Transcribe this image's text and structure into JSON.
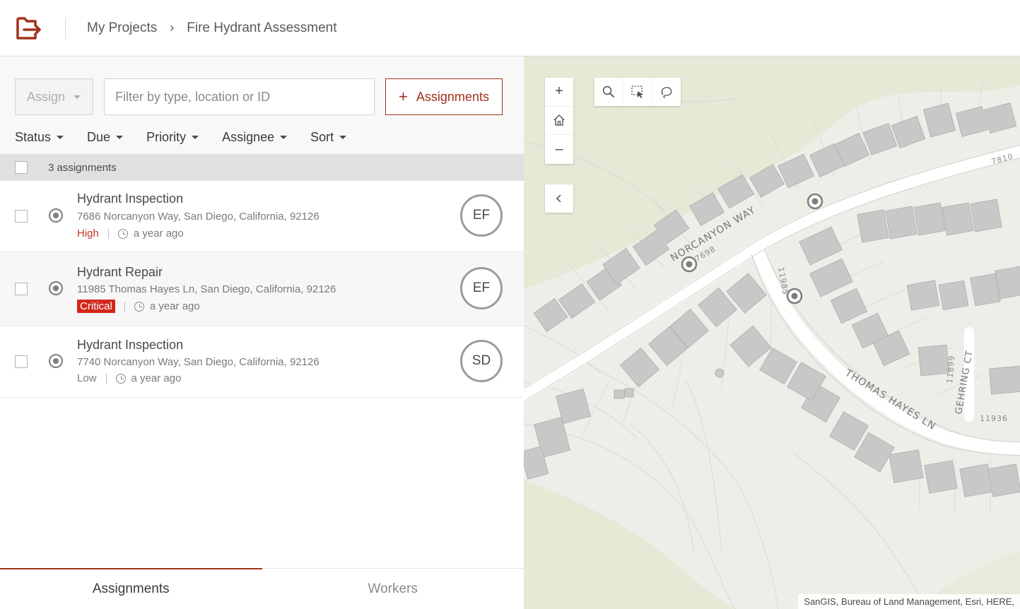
{
  "header": {
    "breadcrumbs": [
      "My Projects",
      "Fire Hydrant Assessment"
    ],
    "brand_color": "#a3301f"
  },
  "toolbar": {
    "assign_label": "Assign",
    "filter_placeholder": "Filter by type, location or ID",
    "add_label": "Assignments",
    "filters": [
      "Status",
      "Due",
      "Priority",
      "Assignee",
      "Sort"
    ]
  },
  "list": {
    "count_text": "3 assignments",
    "items": [
      {
        "title": "Hydrant Inspection",
        "address": "7686 Norcanyon Way, San Diego, California, 92126",
        "priority": "High",
        "time": "a year ago",
        "assignee": "EF"
      },
      {
        "title": "Hydrant Repair",
        "address": "11985 Thomas Hayes Ln, San Diego, California, 92126",
        "priority": "Critical",
        "time": "a year ago",
        "assignee": "EF"
      },
      {
        "title": "Hydrant Inspection",
        "address": "7740 Norcanyon Way, San Diego, California, 92126",
        "priority": "Low",
        "time": "a year ago",
        "assignee": "SD"
      }
    ]
  },
  "tabs": [
    {
      "label": "Assignments"
    },
    {
      "label": "Workers"
    }
  ],
  "map": {
    "zoom_in": "+",
    "zoom_out": "–",
    "streets": {
      "norcanyon": "NORCANYON WAY",
      "thomas_hayes": "THOMAS HAYES LN",
      "gehring": "GEHRING CT"
    },
    "house_numbers": {
      "n7698": "7698",
      "n7810": "7810",
      "n11985": "11985",
      "n11899": "11899",
      "n11936": "11936"
    },
    "attribution": "SanGIS, Bureau of Land Management, Esri, HERE,"
  }
}
